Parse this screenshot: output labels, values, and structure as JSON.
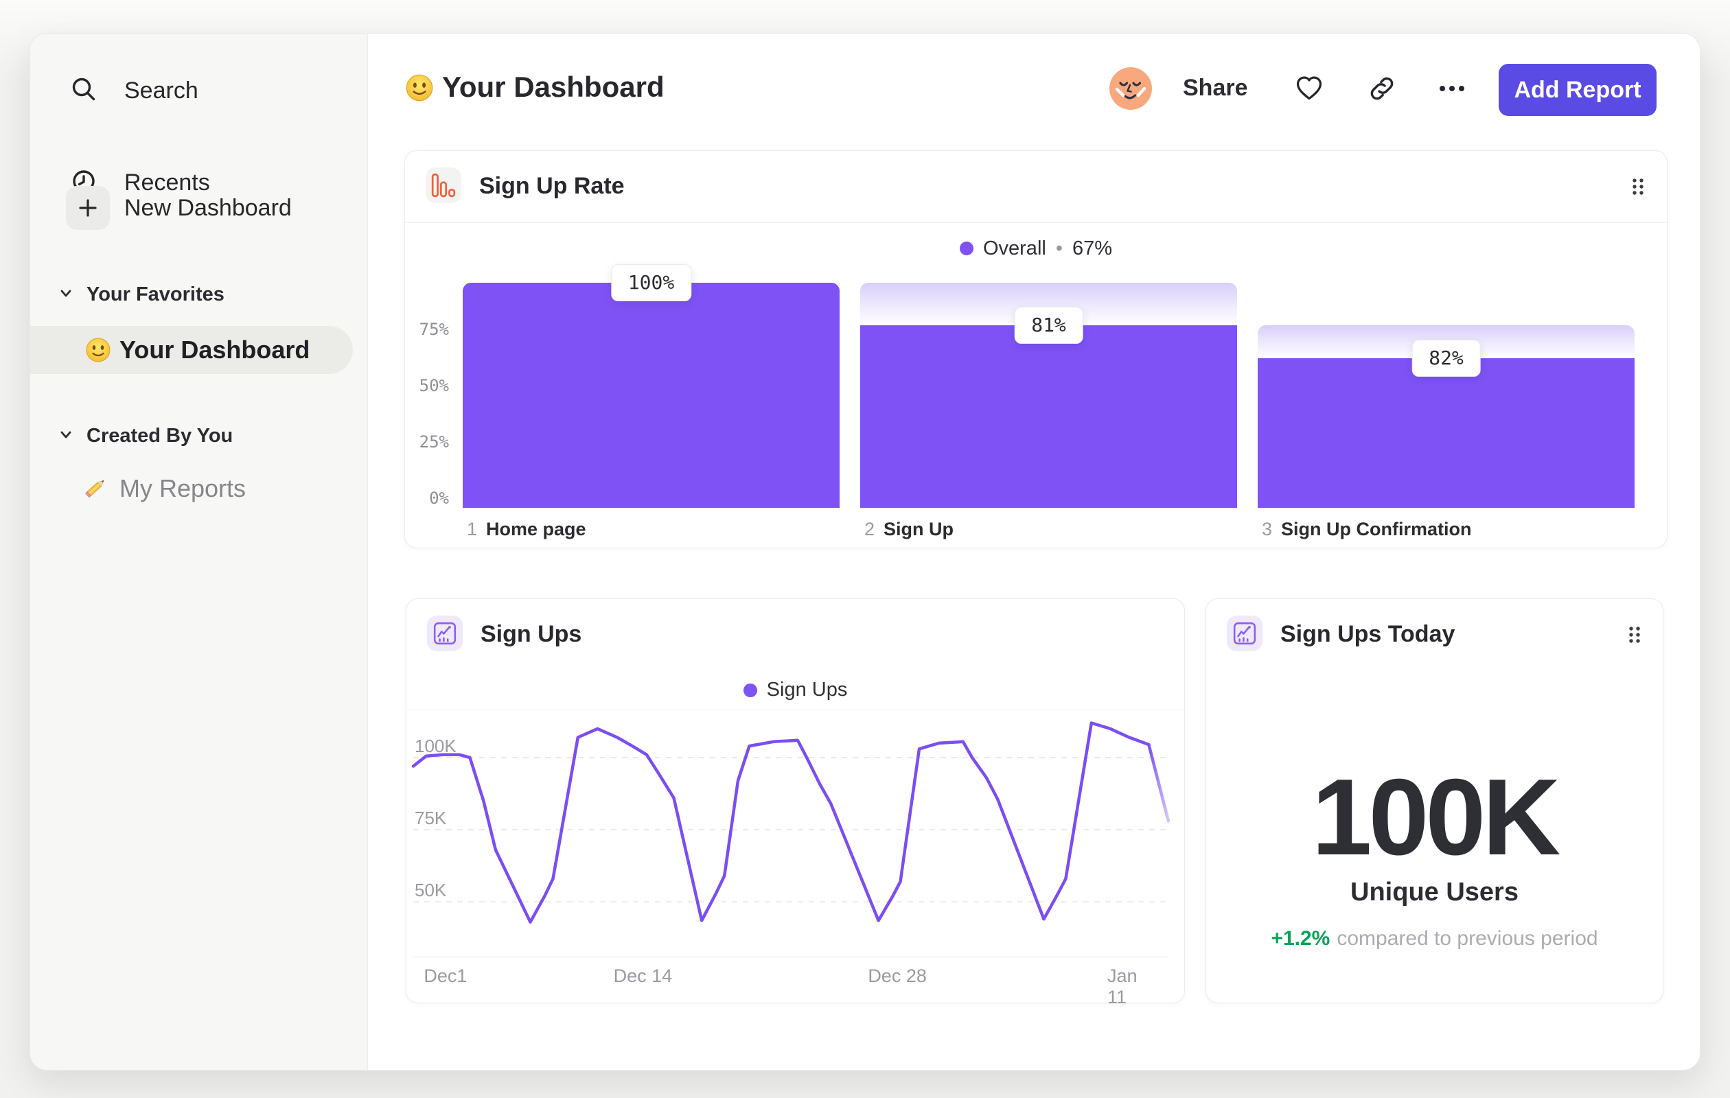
{
  "colors": {
    "accent_button": "#5a4be4",
    "purple_series": "#7e52f5",
    "line_stroke": "#7a4ef2",
    "line_faded": "#d5c8fa",
    "orange_icon": "#ee6140",
    "green_positive": "#0aa259",
    "ghost_gradient_top": "#d9cefa"
  },
  "sidebar": {
    "items": [
      {
        "label": "Search",
        "icon": "search-icon"
      },
      {
        "label": "Recents",
        "icon": "clock-icon"
      },
      {
        "label": "New Dashboard",
        "icon": "plus-icon"
      }
    ],
    "favorites_section": "Your Favorites",
    "favorite_item": "Your Dashboard",
    "created_section": "Created By You",
    "created_item": "My Reports"
  },
  "header": {
    "title": "Your Dashboard",
    "share_label": "Share",
    "add_report_label": "Add Report"
  },
  "cards": {
    "stat": {
      "title": "Sign Ups Today",
      "value": "100K",
      "unit_label": "Unique Users",
      "delta": "+1.2%",
      "delta_caption": "compared to previous period"
    }
  },
  "chart_data": [
    {
      "id": "sign-up-rate-funnel",
      "type": "bar",
      "title": "Sign Up Rate",
      "legend": {
        "label": "Overall",
        "sep": "•",
        "value": "67%"
      },
      "ylabel_ticks": [
        "0%",
        "25%",
        "50%",
        "75%"
      ],
      "ylim": [
        0,
        100
      ],
      "steps": [
        {
          "index": "1",
          "name": "Home page",
          "conversion_label": "100%",
          "overall_pct": 100
        },
        {
          "index": "2",
          "name": "Sign Up",
          "conversion_label": "81%",
          "overall_pct": 81
        },
        {
          "index": "3",
          "name": "Sign Up Confirmation",
          "conversion_label": "82%",
          "overall_pct": 66.4
        }
      ]
    },
    {
      "id": "sign-ups-line",
      "type": "line",
      "title": "Sign Ups",
      "legend": {
        "label": "Sign Ups"
      },
      "unit": "K",
      "grid": "dashed-horizontal",
      "yticks": [
        {
          "label": "100K",
          "value": 100
        },
        {
          "label": "75K",
          "value": 75
        },
        {
          "label": "50K",
          "value": 50
        }
      ],
      "y_top_value": 113.3,
      "y_bottom_value": 31,
      "xticks": [
        {
          "label": "Dec1",
          "frac": 0.014,
          "align": "left"
        },
        {
          "label": "Dec 14",
          "frac": 0.304,
          "align": "center"
        },
        {
          "label": "Dec 28",
          "frac": 0.641,
          "align": "center"
        },
        {
          "label": "Jan 11",
          "frac": 0.953,
          "align": "center"
        }
      ],
      "projection_start_frac": 0.974,
      "points": [
        [
          0.0,
          97
        ],
        [
          0.017,
          100.5
        ],
        [
          0.039,
          101
        ],
        [
          0.061,
          101
        ],
        [
          0.075,
          100
        ],
        [
          0.093,
          85
        ],
        [
          0.109,
          68
        ],
        [
          0.155,
          43
        ],
        [
          0.174,
          52
        ],
        [
          0.185,
          58
        ],
        [
          0.218,
          107
        ],
        [
          0.244,
          110
        ],
        [
          0.27,
          107
        ],
        [
          0.29,
          104
        ],
        [
          0.309,
          101
        ],
        [
          0.326,
          94
        ],
        [
          0.345,
          86
        ],
        [
          0.382,
          43.5
        ],
        [
          0.401,
          53
        ],
        [
          0.412,
          59
        ],
        [
          0.43,
          92
        ],
        [
          0.445,
          104
        ],
        [
          0.477,
          105.5
        ],
        [
          0.509,
          106
        ],
        [
          0.521,
          100
        ],
        [
          0.538,
          91
        ],
        [
          0.553,
          84
        ],
        [
          0.616,
          43.5
        ],
        [
          0.635,
          52
        ],
        [
          0.645,
          57
        ],
        [
          0.67,
          103
        ],
        [
          0.696,
          105
        ],
        [
          0.728,
          105.5
        ],
        [
          0.74,
          100
        ],
        [
          0.759,
          93
        ],
        [
          0.774,
          85.5
        ],
        [
          0.835,
          44
        ],
        [
          0.854,
          53
        ],
        [
          0.864,
          58
        ],
        [
          0.898,
          112
        ],
        [
          0.923,
          110
        ],
        [
          0.948,
          107
        ],
        [
          0.974,
          104.5
        ],
        [
          1.0,
          78
        ]
      ]
    }
  ]
}
